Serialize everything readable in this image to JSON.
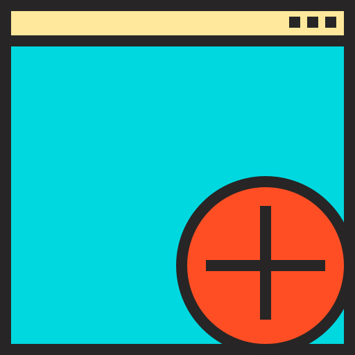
{
  "icon": {
    "name": "add-window-icon",
    "parts": {
      "window": "browser-window",
      "title_bar": "title-bar",
      "window_controls": [
        "control-dot",
        "control-dot",
        "control-dot"
      ],
      "badge": "add-badge",
      "badge_symbol": "plus-icon"
    }
  },
  "colors": {
    "outline": "#272525",
    "title_bar": "#FFE89B",
    "window_body": "#00D8E0",
    "badge": "#FF4E24"
  }
}
